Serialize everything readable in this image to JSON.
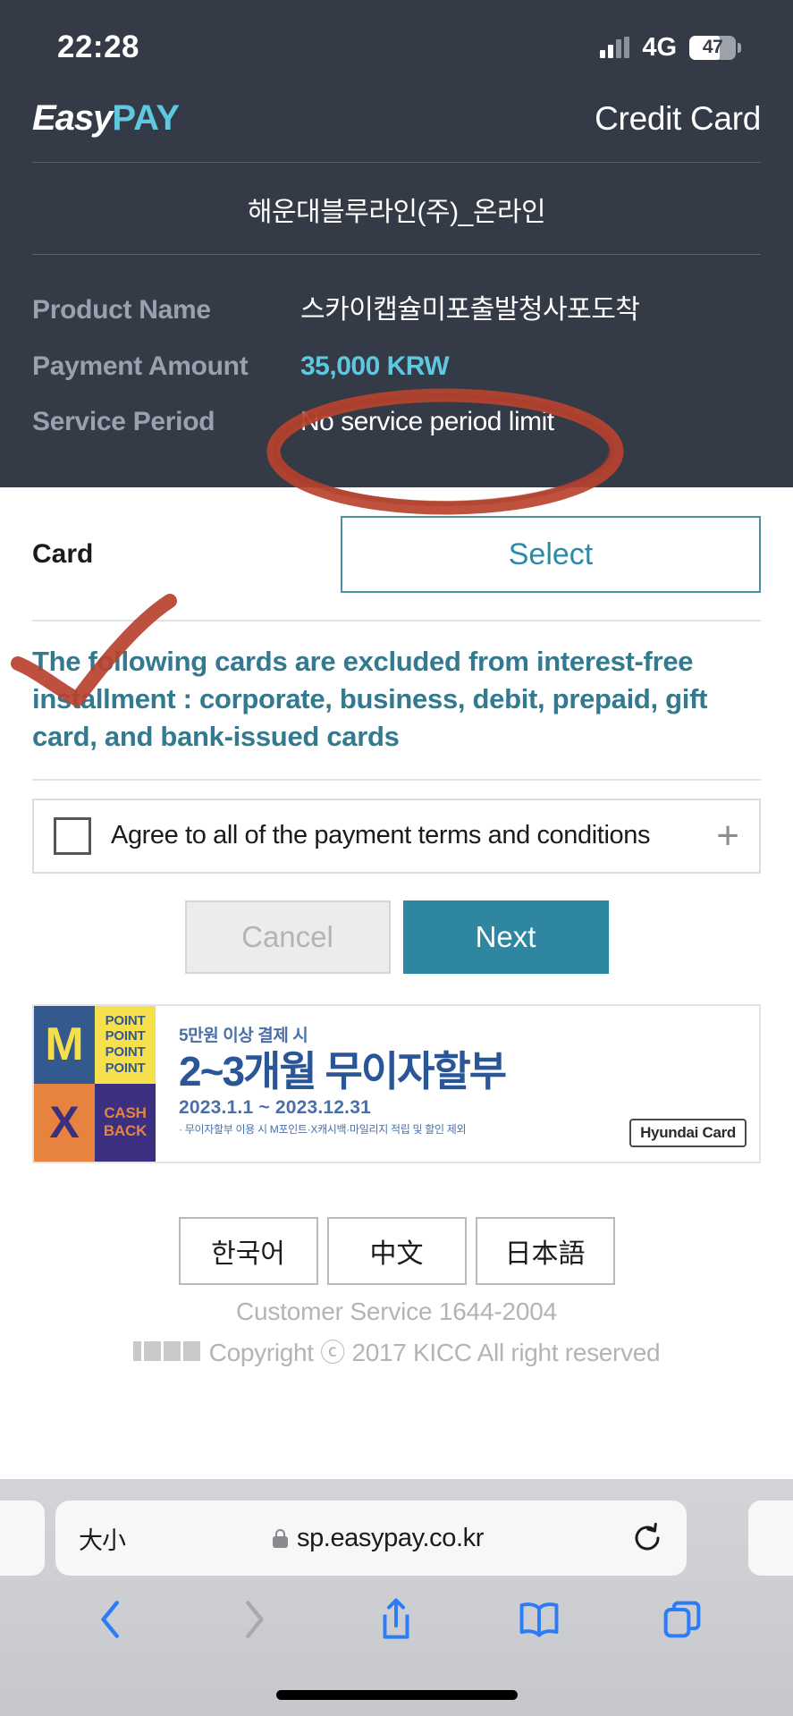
{
  "status_bar": {
    "time": "22:28",
    "network": "4G",
    "battery": "47",
    "signal_icon": "cellular-signal-icon",
    "battery_icon": "battery-icon"
  },
  "header": {
    "logo_easy": "Easy",
    "logo_pay": "PAY",
    "title": "Credit Card",
    "merchant": "해운대블루라인(주)_온라인",
    "rows": [
      {
        "label": "Product Name",
        "value": "스카이캡슐미포출발청사포도착",
        "accent": false
      },
      {
        "label": "Payment Amount",
        "value": "35,000 KRW",
        "accent": true
      },
      {
        "label": "Service Period",
        "value": "No service period limit",
        "accent": false
      }
    ]
  },
  "card_section": {
    "label": "Card",
    "select_button": "Select",
    "notice": "The following cards are excluded from interest-free installment : corporate, business, debit, prepaid, gift card, and bank-issued cards"
  },
  "agreement": {
    "text": "Agree to all of the payment terms and conditions",
    "expand_icon": "plus-icon",
    "checked": false
  },
  "actions": {
    "cancel": "Cancel",
    "next": "Next"
  },
  "promo": {
    "logo": {
      "m": "M",
      "point": "POINT\nPOINT\nPOINT\nPOINT",
      "x": "X",
      "cash": "CASH\nBACK"
    },
    "kicker": "5만원 이상 결제 시",
    "headline": "2~3개월 무이자할부",
    "date_range": "2023.1.1 ~ 2023.12.31",
    "fine_print": "· 무이자할부 이용 시 M포인트·X캐시백·마일리지 적립 및 할인 제외",
    "brand_badge": "Hyundai Card"
  },
  "footer": {
    "languages": [
      "한국어",
      "中文",
      "日本語"
    ],
    "customer_service": "Customer Service 1644-2004",
    "copyright": "Copyright ⓒ 2017 KICC All right reserved",
    "kicc_logo": "kicc-logo"
  },
  "annotations": {
    "ellipse_color": "#b8432f",
    "check_color": "#b8432f"
  },
  "browser": {
    "text_size_label": "大小",
    "url": "sp.easypay.co.kr",
    "lock_icon": "lock-icon",
    "reload_icon": "reload-icon",
    "back_icon": "chevron-left-icon",
    "forward_icon": "chevron-right-icon",
    "share_icon": "share-icon",
    "bookmarks_icon": "book-icon",
    "tabs_icon": "tabs-icon"
  },
  "colors": {
    "header_bg": "#343a46",
    "accent_teal": "#2e86a0",
    "amount_cyan": "#5ec8e0",
    "notice_teal": "#33798f",
    "annotation_red": "#b8432f"
  }
}
